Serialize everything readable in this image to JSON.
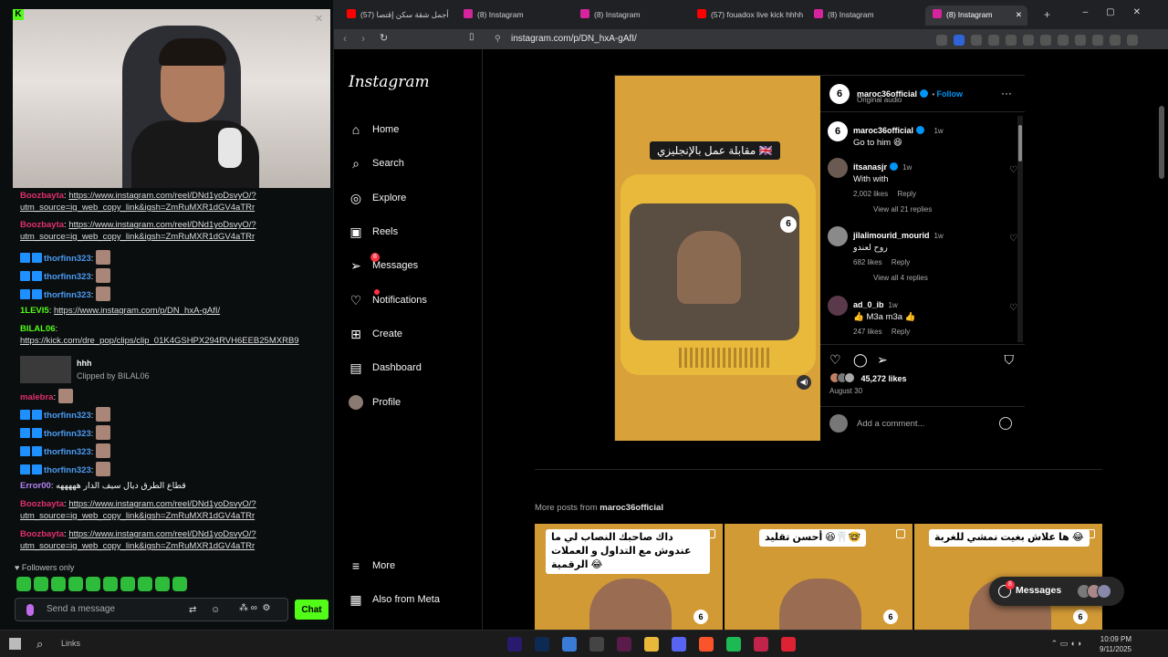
{
  "kick": {
    "chat_messages": [
      {
        "user": "Boozbayta",
        "user_color": "#e0306b",
        "text": "https://www.instagram.com/reel/DNd1yoDsvyO/?utm_source=ig_web_copy_link&igsh=ZmRuMXR1dGV4aTRr",
        "is_link": true
      },
      {
        "user": "Boozbayta",
        "user_color": "#e0306b",
        "text": "https://www.instagram.com/reel/DNd1yoDsvyO/?utm_source=ig_web_copy_link&igsh=ZmRuMXR1dGV4aTRr",
        "is_link": true
      },
      {
        "user": "thorfinn323",
        "user_color": "#4a9cf5",
        "text": "",
        "is_link": false
      },
      {
        "user": "thorfinn323",
        "user_color": "#4a9cf5",
        "text": "",
        "is_link": false
      },
      {
        "user": "thorfinn323",
        "user_color": "#4a9cf5",
        "text": "",
        "is_link": false
      },
      {
        "user": "1LEVI5",
        "user_color": "#53fc18",
        "text": "https://www.instagram.com/p/DN_hxA-gAfI/",
        "is_link": true
      },
      {
        "user": "BILAL06",
        "user_color": "#53fc18",
        "text": "https://kick.com/dre_pop/clips/clip_01K4GSHPX294RVH6EEB25MXRB9",
        "is_link": true
      },
      {
        "user": "malebra",
        "user_color": "#e0306b",
        "text": "",
        "is_link": false
      },
      {
        "user": "thorfinn323",
        "user_color": "#4a9cf5",
        "text": "",
        "is_link": false
      },
      {
        "user": "thorfinn323",
        "user_color": "#4a9cf5",
        "text": "",
        "is_link": false
      },
      {
        "user": "thorfinn323",
        "user_color": "#4a9cf5",
        "text": "",
        "is_link": false
      },
      {
        "user": "thorfinn323",
        "user_color": "#4a9cf5",
        "text": "",
        "is_link": false
      },
      {
        "user": "Error00",
        "user_color": "#b383f5",
        "text": "قطاع الطرق ديال سيف الدار هههههه",
        "is_link": false
      },
      {
        "user": "Boozbayta",
        "user_color": "#e0306b",
        "text": "https://www.instagram.com/reel/DNd1yoDsvyO/?utm_source=ig_web_copy_link&igsh=ZmRuMXR1dGV4aTRr",
        "is_link": true
      },
      {
        "user": "Boozbayta",
        "user_color": "#e0306b",
        "text": "https://www.instagram.com/reel/DNd1yoDsvyO/?utm_source=ig_web_copy_link&igsh=ZmRuMXR1dGV4aTRr",
        "is_link": true
      }
    ],
    "clip": {
      "title": "hhh",
      "by": "Clipped by BILAL06"
    },
    "followers_only": "Followers only",
    "send_placeholder": "Send a message",
    "chat_button": "Chat",
    "brand_color": "#53fc18"
  },
  "browser": {
    "tabs": [
      {
        "label": "(57) أجمل شقة سكن إقتصا",
        "icon_color": "#ff0000",
        "active": false
      },
      {
        "label": "(8) Instagram",
        "icon_color": "#d6249f",
        "active": false
      },
      {
        "label": "(8) Instagram",
        "icon_color": "#d6249f",
        "active": false
      },
      {
        "label": "(57) fouadox live kick hhhh",
        "icon_color": "#ff0000",
        "active": false
      },
      {
        "label": "(8) Instagram",
        "icon_color": "#d6249f",
        "active": false
      },
      {
        "label": "(8) Instagram",
        "icon_color": "#d6249f",
        "active": true
      }
    ],
    "url": "instagram.com/p/DN_hxA-gAfI/"
  },
  "instagram": {
    "logo": "Instagram",
    "nav": [
      {
        "label": "Home",
        "icon": "home-icon",
        "glyph": "⌂"
      },
      {
        "label": "Search",
        "icon": "search-icon",
        "glyph": "⌕"
      },
      {
        "label": "Explore",
        "icon": "explore-icon",
        "glyph": "◎"
      },
      {
        "label": "Reels",
        "icon": "reels-icon",
        "glyph": "▣"
      },
      {
        "label": "Messages",
        "icon": "messages-icon",
        "glyph": "➢",
        "badge": "8"
      },
      {
        "label": "Notifications",
        "icon": "heart-icon",
        "glyph": "♡"
      },
      {
        "label": "Create",
        "icon": "create-icon",
        "glyph": "⊞"
      },
      {
        "label": "Dashboard",
        "icon": "dashboard-icon",
        "glyph": "▤"
      },
      {
        "label": "Profile",
        "icon": "profile-avatar",
        "glyph": ""
      }
    ],
    "nav_more": "More",
    "nav_meta": "Also from Meta",
    "post": {
      "media_caption": "مقابلة عمل بالإنجليزي 🇬🇧",
      "author": "maroc36official",
      "follow": "Follow",
      "audio": "Original audio",
      "caption_author": "maroc36official",
      "caption_time": "1w",
      "caption_text": "Go to him 😆",
      "comments": [
        {
          "user": "itsanasjr",
          "time": "1w",
          "text": "With with",
          "likes": "2,002 likes",
          "reply": "Reply",
          "view_replies": "View all 21 replies"
        },
        {
          "user": "jilalimourid_mourid",
          "time": "1w",
          "text": "روح لعندو",
          "likes": "682 likes",
          "reply": "Reply",
          "view_replies": "View all 4 replies"
        },
        {
          "user": "ad_0_ib",
          "time": "1w",
          "text": "👍 M3a m3a 👍",
          "likes": "247 likes",
          "reply": "Reply",
          "view_replies": ""
        }
      ],
      "likes": "45,272 likes",
      "date": "August 30",
      "add_comment": "Add a comment..."
    },
    "more_posts_prefix": "More posts from",
    "more_posts_user": "maroc36official",
    "more_posts": [
      {
        "caption": "داك صاحبك النصاب لي ما عندوش مع التداول و العملات الرقمية 😂"
      },
      {
        "caption": "أحسن تقليد 😆🦷🤓"
      },
      {
        "caption": "ها علاش بغيت نمشي للغربة 😂"
      }
    ],
    "messages_pill": "Messages",
    "messages_count": "8"
  },
  "taskbar": {
    "links": "Links",
    "time": "10:09 PM",
    "date": "9/11/2025"
  }
}
